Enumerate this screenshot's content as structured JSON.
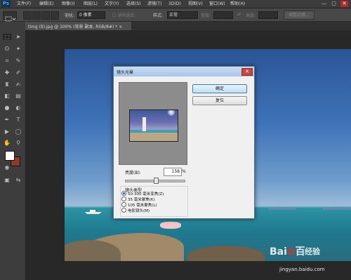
{
  "app": {
    "logo": "Ps"
  },
  "menu": [
    "文件(F)",
    "编辑(E)",
    "图像(I)",
    "图层(L)",
    "文字(Y)",
    "选择(S)",
    "滤镜(T)",
    "3D(D)",
    "视图(V)",
    "窗口(W)",
    "帮助(H)"
  ],
  "window_controls": {
    "minimize": "—",
    "maximize": "□",
    "close": "✕"
  },
  "options": {
    "feather_label": "羽化:",
    "feather_value": "0 像素",
    "antialias_label": "消除锯齿",
    "style_label": "样式:",
    "style_value": "正常",
    "width_label": "宽度:",
    "height_label": "高度:",
    "refine_edge": "调整边缘..."
  },
  "document_tab": {
    "title": "timg (9).jpg @ 100% (背景 副本, RGB/8#) *",
    "close": "×"
  },
  "colors": {
    "foreground": "#ffffff",
    "background": "#8b3a2c",
    "accent": "#3c7fb1"
  },
  "dialog": {
    "title": "镜头光晕",
    "close": "✕",
    "ok": "确定",
    "reset": "复位",
    "brightness_label": "亮度(B):",
    "brightness_value": "158",
    "brightness_unit": "%",
    "brightness_percent": 158,
    "brightness_slider_range": [
      10,
      300
    ],
    "lens_type_label": "镜头类型",
    "lens_types": [
      {
        "label": "50-300 毫米变焦(Z)",
        "selected": true
      },
      {
        "label": "35 毫米聚焦(K)",
        "selected": false
      },
      {
        "label": "105 毫米聚焦(L)",
        "selected": false
      },
      {
        "label": "电影镜头(M)",
        "selected": false
      }
    ]
  },
  "watermark": {
    "logo": "Bai",
    "logo_paw": "✿",
    "logo_suffix": "百",
    "text": "经验",
    "url": "jingyan.baidu.com"
  }
}
